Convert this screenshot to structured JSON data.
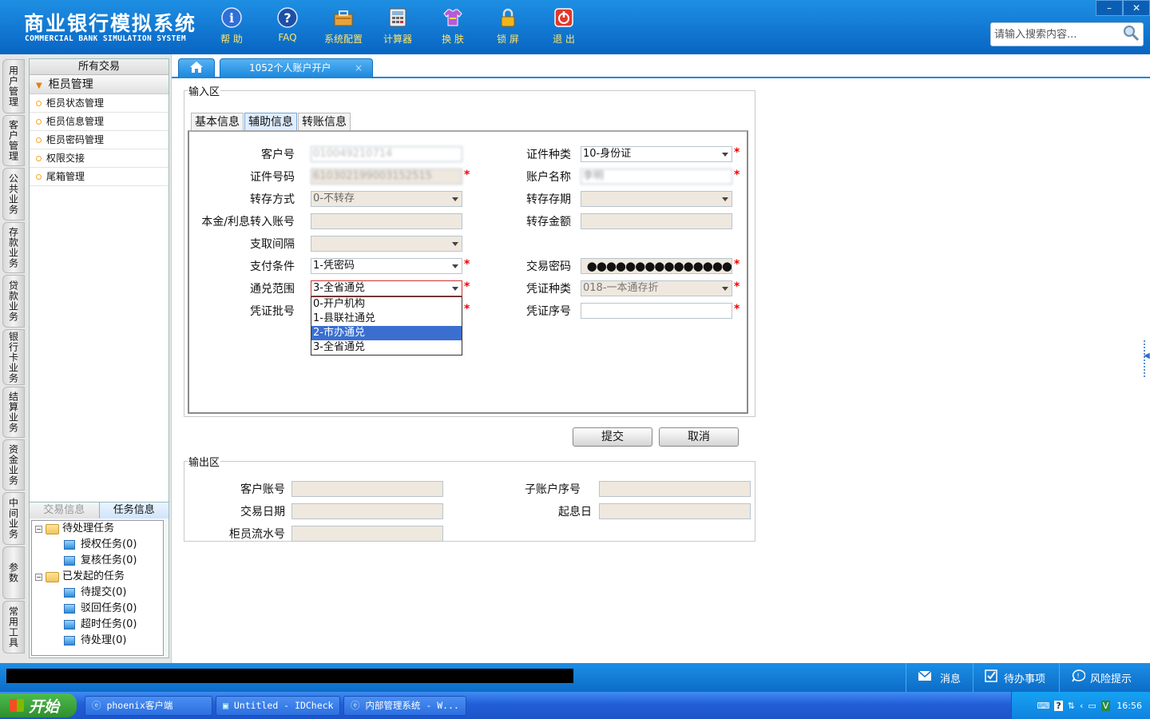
{
  "app": {
    "title_cn": "商业银行模拟系统",
    "title_en": "COMMERCIAL BANK SIMULATION SYSTEM"
  },
  "toolbar": [
    {
      "label": "帮 助",
      "icon": "info-icon"
    },
    {
      "label": "FAQ",
      "icon": "help-icon"
    },
    {
      "label": "系统配置",
      "icon": "toolbox-icon"
    },
    {
      "label": "计算器",
      "icon": "calculator-icon"
    },
    {
      "label": "换 肤",
      "icon": "shirt-icon"
    },
    {
      "label": "锁 屏",
      "icon": "lock-icon"
    },
    {
      "label": "退 出",
      "icon": "power-icon"
    }
  ],
  "window_controls": {
    "minimize": "–",
    "close": "✕"
  },
  "search": {
    "placeholder": "请输入搜索内容..."
  },
  "vtabs": [
    "用户管理",
    "客户管理",
    "公共业务",
    "存款业务",
    "贷款业务",
    "银行卡业务",
    "结算业务",
    "资金业务",
    "中间业务",
    "参数",
    "常用工具"
  ],
  "nav": {
    "header": "所有交易",
    "group": "柜员管理",
    "items": [
      "柜员状态管理",
      "柜员信息管理",
      "柜员密码管理",
      "权限交接",
      "尾箱管理"
    ]
  },
  "task_panel": {
    "tabs": [
      "交易信息",
      "任务信息"
    ],
    "pending": "待处理任务",
    "pending_items": [
      "授权任务(0)",
      "复核任务(0)"
    ],
    "initiated": "已发起的任务",
    "initiated_items": [
      "待提交(0)",
      "驳回任务(0)",
      "超时任务(0)",
      "待处理(0)"
    ]
  },
  "tabs": {
    "active_tab": "1052个人账户开户",
    "close": "×"
  },
  "input_area": {
    "legend": "输入区",
    "form_tabs": [
      "基本信息",
      "辅助信息",
      "转账信息"
    ],
    "fields": {
      "customer_no": {
        "label": "客户号",
        "value": "010049210714"
      },
      "id_type": {
        "label": "证件种类",
        "value": "10-身份证"
      },
      "id_no": {
        "label": "证件号码",
        "value": "610302199003152515"
      },
      "account_name": {
        "label": "账户名称",
        "value": "李明"
      },
      "transfer_mode": {
        "label": "转存方式",
        "value": "0-不转存"
      },
      "transfer_term": {
        "label": "转存存期",
        "value": ""
      },
      "interest_account": {
        "label": "本金/利息转入账号",
        "value": ""
      },
      "transfer_amount": {
        "label": "转存金额",
        "value": ""
      },
      "withdraw_interval": {
        "label": "支取间隔",
        "value": ""
      },
      "pay_condition": {
        "label": "支付条件",
        "value": "1-凭密码"
      },
      "trade_password": {
        "label": "交易密码",
        "value": "●●●●●●●●●●●●●●●"
      },
      "exchange_scope": {
        "label": "通兑范围",
        "value": "3-全省通兑"
      },
      "voucher_type": {
        "label": "凭证种类",
        "value": "018-一本通存折"
      },
      "voucher_batch": {
        "label": "凭证批号",
        "value": ""
      },
      "voucher_seq": {
        "label": "凭证序号",
        "value": ""
      }
    },
    "scope_options": [
      "0-开户机构",
      "1-县联社通兑",
      "2-市办通兑",
      "3-全省通兑"
    ],
    "highlighted_option": "2-市办通兑"
  },
  "actions": {
    "submit": "提交",
    "cancel": "取消"
  },
  "output_area": {
    "legend": "输出区",
    "customer_account": "客户账号",
    "sub_account_seq": "子账户序号",
    "trade_date": "交易日期",
    "value_date": "起息日",
    "teller_serial": "柜员流水号"
  },
  "statusbar": {
    "message": "消息",
    "todo": "待办事项",
    "risk": "风险提示"
  },
  "taskbar": {
    "start": "开始",
    "tasks": [
      "phoenix客户端",
      "Untitled - IDCheck",
      "内部管理系统 - W..."
    ],
    "time": "16:56"
  },
  "colors": {
    "header_blue": "#0b72d0",
    "accent_yellow": "#ffe56a",
    "required_red": "#e00000",
    "highlight": "#3a6fd0"
  }
}
